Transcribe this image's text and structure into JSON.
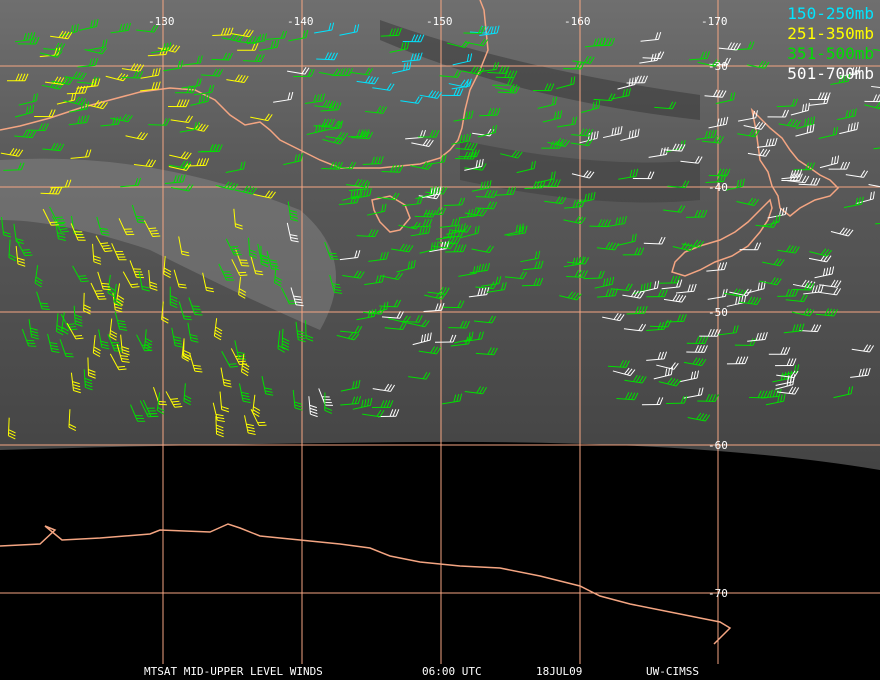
{
  "map": {
    "lon_labels": [
      "-130",
      "-140",
      "-150",
      "-160",
      "-170"
    ],
    "lat_labels": [
      "-30",
      "-40",
      "-50",
      "-60",
      "-70"
    ],
    "grid_color": "#f4a582",
    "coast_color": "#f4a582"
  },
  "legend": [
    {
      "label": "150-250mb",
      "color": "#00e5ff"
    },
    {
      "label": "251-350mb",
      "color": "#ffff00"
    },
    {
      "label": "351-500mb",
      "color": "#00e000"
    },
    {
      "label": "501-700mb",
      "color": "#ffffff"
    }
  ],
  "footer": {
    "product": "MTSAT MID-UPPER LEVEL WINDS",
    "time": "06:00 UTC",
    "date": "18JUL09",
    "source": "UW-CIMSS"
  }
}
